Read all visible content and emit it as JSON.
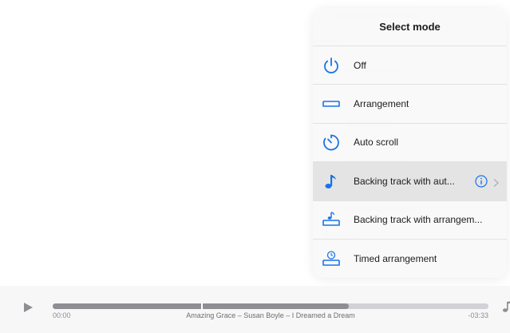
{
  "mode_popover": {
    "title": "Select mode",
    "items": [
      {
        "label": "Off",
        "icon": "power-icon",
        "selected": false
      },
      {
        "label": "Arrangement",
        "icon": "arrangement-icon",
        "selected": false
      },
      {
        "label": "Auto scroll",
        "icon": "timer-icon",
        "selected": false
      },
      {
        "label": "Backing track with aut...",
        "icon": "music-note-icon",
        "selected": true
      },
      {
        "label": "Backing track with arrangem...",
        "icon": "backing-arrangement-icon",
        "selected": false
      },
      {
        "label": "Timed arrangement",
        "icon": "timed-arrangement-icon",
        "selected": false
      }
    ],
    "accent_color": "#1a73e8"
  },
  "player": {
    "elapsed": "00:00",
    "remaining": "-03:33",
    "track_info": "Amazing Grace  –  Susan Boyle  –  I Dreamed a Dream",
    "progress": 0.68,
    "marker": 0.34
  }
}
